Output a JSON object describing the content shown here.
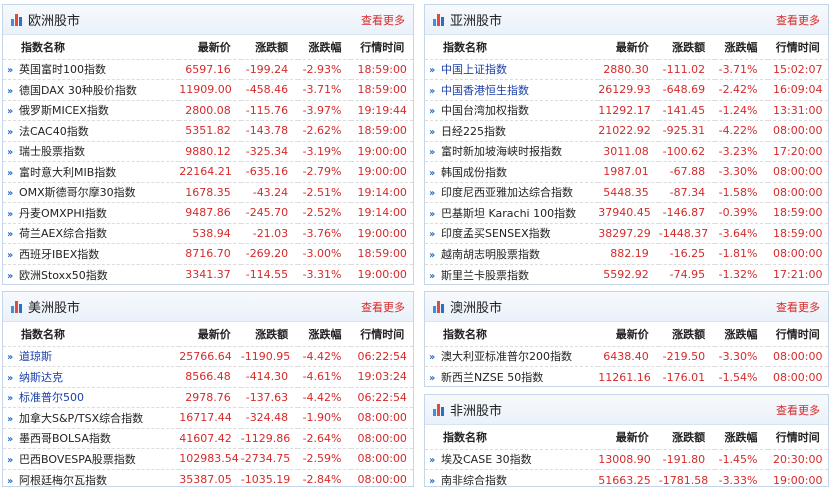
{
  "headers": {
    "name": "指数名称",
    "price": "最新价",
    "change": "涨跌额",
    "pct": "涨跌幅",
    "time": "行情时间"
  },
  "more_label": "查看更多",
  "europe": {
    "title": "欧洲股市",
    "rows": [
      {
        "name": "英国富时100指数",
        "price": "6597.16",
        "change": "-199.24",
        "pct": "-2.93%",
        "time": "18:59:00"
      },
      {
        "name": "德国DAX 30种股价指数",
        "price": "11909.00",
        "change": "-458.46",
        "pct": "-3.71%",
        "time": "18:59:00"
      },
      {
        "name": "俄罗斯MICEX指数",
        "price": "2800.08",
        "change": "-115.76",
        "pct": "-3.97%",
        "time": "19:19:44"
      },
      {
        "name": "法CAC40指数",
        "price": "5351.82",
        "change": "-143.78",
        "pct": "-2.62%",
        "time": "18:59:00"
      },
      {
        "name": "瑞士股票指数",
        "price": "9880.12",
        "change": "-325.34",
        "pct": "-3.19%",
        "time": "19:00:00"
      },
      {
        "name": "富时意大利MIB指数",
        "price": "22164.21",
        "change": "-635.16",
        "pct": "-2.79%",
        "time": "19:00:00"
      },
      {
        "name": "OMX斯德哥尔摩30指数",
        "price": "1678.35",
        "change": "-43.24",
        "pct": "-2.51%",
        "time": "19:14:00"
      },
      {
        "name": "丹麦OMXPHI指数",
        "price": "9487.86",
        "change": "-245.70",
        "pct": "-2.52%",
        "time": "19:14:00"
      },
      {
        "name": "荷兰AEX综合指数",
        "price": "538.94",
        "change": "-21.03",
        "pct": "-3.76%",
        "time": "19:00:00"
      },
      {
        "name": "西班牙IBEX指数",
        "price": "8716.70",
        "change": "-269.20",
        "pct": "-3.00%",
        "time": "18:59:00"
      },
      {
        "name": "欧洲Stoxx50指数",
        "price": "3341.37",
        "change": "-114.55",
        "pct": "-3.31%",
        "time": "19:00:00"
      }
    ]
  },
  "asia": {
    "title": "亚洲股市",
    "rows": [
      {
        "name": "中国上证指数",
        "price": "2880.30",
        "change": "-111.02",
        "pct": "-3.71%",
        "time": "15:02:07",
        "blue": true
      },
      {
        "name": "中国香港恒生指数",
        "price": "26129.93",
        "change": "-648.69",
        "pct": "-2.42%",
        "time": "16:09:04",
        "blue": true
      },
      {
        "name": "中国台湾加权指数",
        "price": "11292.17",
        "change": "-141.45",
        "pct": "-1.24%",
        "time": "13:31:00"
      },
      {
        "name": "日经225指数",
        "price": "21022.92",
        "change": "-925.31",
        "pct": "-4.22%",
        "time": "08:00:00"
      },
      {
        "name": "富时新加坡海峡时报指数",
        "price": "3011.08",
        "change": "-100.62",
        "pct": "-3.23%",
        "time": "17:20:00"
      },
      {
        "name": "韩国成份指数",
        "price": "1987.01",
        "change": "-67.88",
        "pct": "-3.30%",
        "time": "08:00:00"
      },
      {
        "name": "印度尼西亚雅加达综合指数",
        "price": "5448.35",
        "change": "-87.34",
        "pct": "-1.58%",
        "time": "08:00:00"
      },
      {
        "name": "巴基斯坦 Karachi 100指数",
        "price": "37940.45",
        "change": "-146.87",
        "pct": "-0.39%",
        "time": "18:59:00"
      },
      {
        "name": "印度孟买SENSEX指数",
        "price": "38297.29",
        "change": "-1448.37",
        "pct": "-3.64%",
        "time": "18:59:00"
      },
      {
        "name": "越南胡志明股票指数",
        "price": "882.19",
        "change": "-16.25",
        "pct": "-1.81%",
        "time": "08:00:00"
      },
      {
        "name": "斯里兰卡股票指数",
        "price": "5592.92",
        "change": "-74.95",
        "pct": "-1.32%",
        "time": "17:21:00"
      }
    ]
  },
  "americas": {
    "title": "美洲股市",
    "rows": [
      {
        "name": "道琼斯",
        "price": "25766.64",
        "change": "-1190.95",
        "pct": "-4.42%",
        "time": "06:22:54",
        "blue": true
      },
      {
        "name": "纳斯达克",
        "price": "8566.48",
        "change": "-414.30",
        "pct": "-4.61%",
        "time": "19:03:24",
        "blue": true
      },
      {
        "name": "标准普尔500",
        "price": "2978.76",
        "change": "-137.63",
        "pct": "-4.42%",
        "time": "06:22:54",
        "blue": true
      },
      {
        "name": "加拿大S&P/TSX综合指数",
        "price": "16717.44",
        "change": "-324.48",
        "pct": "-1.90%",
        "time": "08:00:00"
      },
      {
        "name": "墨西哥BOLSA指数",
        "price": "41607.42",
        "change": "-1129.86",
        "pct": "-2.64%",
        "time": "08:00:00"
      },
      {
        "name": "巴西BOVESPA股票指数",
        "price": "102983.54",
        "change": "-2734.75",
        "pct": "-2.59%",
        "time": "08:00:00"
      },
      {
        "name": "阿根廷梅尔瓦指数",
        "price": "35387.05",
        "change": "-1035.19",
        "pct": "-2.84%",
        "time": "08:00:00"
      }
    ]
  },
  "oceania": {
    "title": "澳洲股市",
    "rows": [
      {
        "name": "澳大利亚标准普尔200指数",
        "price": "6438.40",
        "change": "-219.50",
        "pct": "-3.30%",
        "time": "08:00:00"
      },
      {
        "name": "新西兰NZSE 50指数",
        "price": "11261.16",
        "change": "-176.01",
        "pct": "-1.54%",
        "time": "08:00:00"
      }
    ]
  },
  "africa": {
    "title": "非洲股市",
    "rows": [
      {
        "name": "埃及CASE 30指数",
        "price": "13008.90",
        "change": "-191.80",
        "pct": "-1.45%",
        "time": "20:30:00"
      },
      {
        "name": "南非综合指数",
        "price": "51663.25",
        "change": "-1781.58",
        "pct": "-3.33%",
        "time": "19:00:00"
      }
    ]
  }
}
